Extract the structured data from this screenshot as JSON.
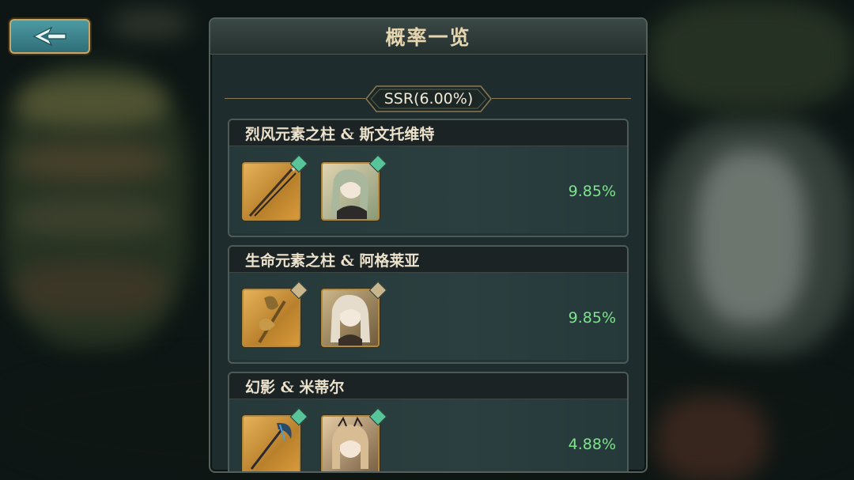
{
  "panel": {
    "title": "概率一览",
    "rate_badge": "SSR(6.00%)"
  },
  "back_button": {
    "icon": "back-arrow-icon"
  },
  "colors": {
    "rate_text": "#7de48a",
    "gem_green": "#58c49a",
    "gem_tan": "#c9b68c",
    "frame_gold": "#b08a3e"
  },
  "entries": [
    {
      "name": "烈风元素之柱 & 斯文托维特",
      "rate": "9.85%",
      "weapon_icon": "spear-weapon-icon",
      "character_icon": "character-portrait-icon",
      "gem": "green"
    },
    {
      "name": "生命元素之柱 & 阿格莱亚",
      "rate": "9.85%",
      "weapon_icon": "staff-weapon-icon",
      "character_icon": "character-portrait-icon",
      "gem": "tan"
    },
    {
      "name": "幻影 & 米蒂尔",
      "rate": "4.88%",
      "weapon_icon": "scythe-weapon-icon",
      "character_icon": "character-portrait-icon",
      "gem": "green"
    }
  ]
}
